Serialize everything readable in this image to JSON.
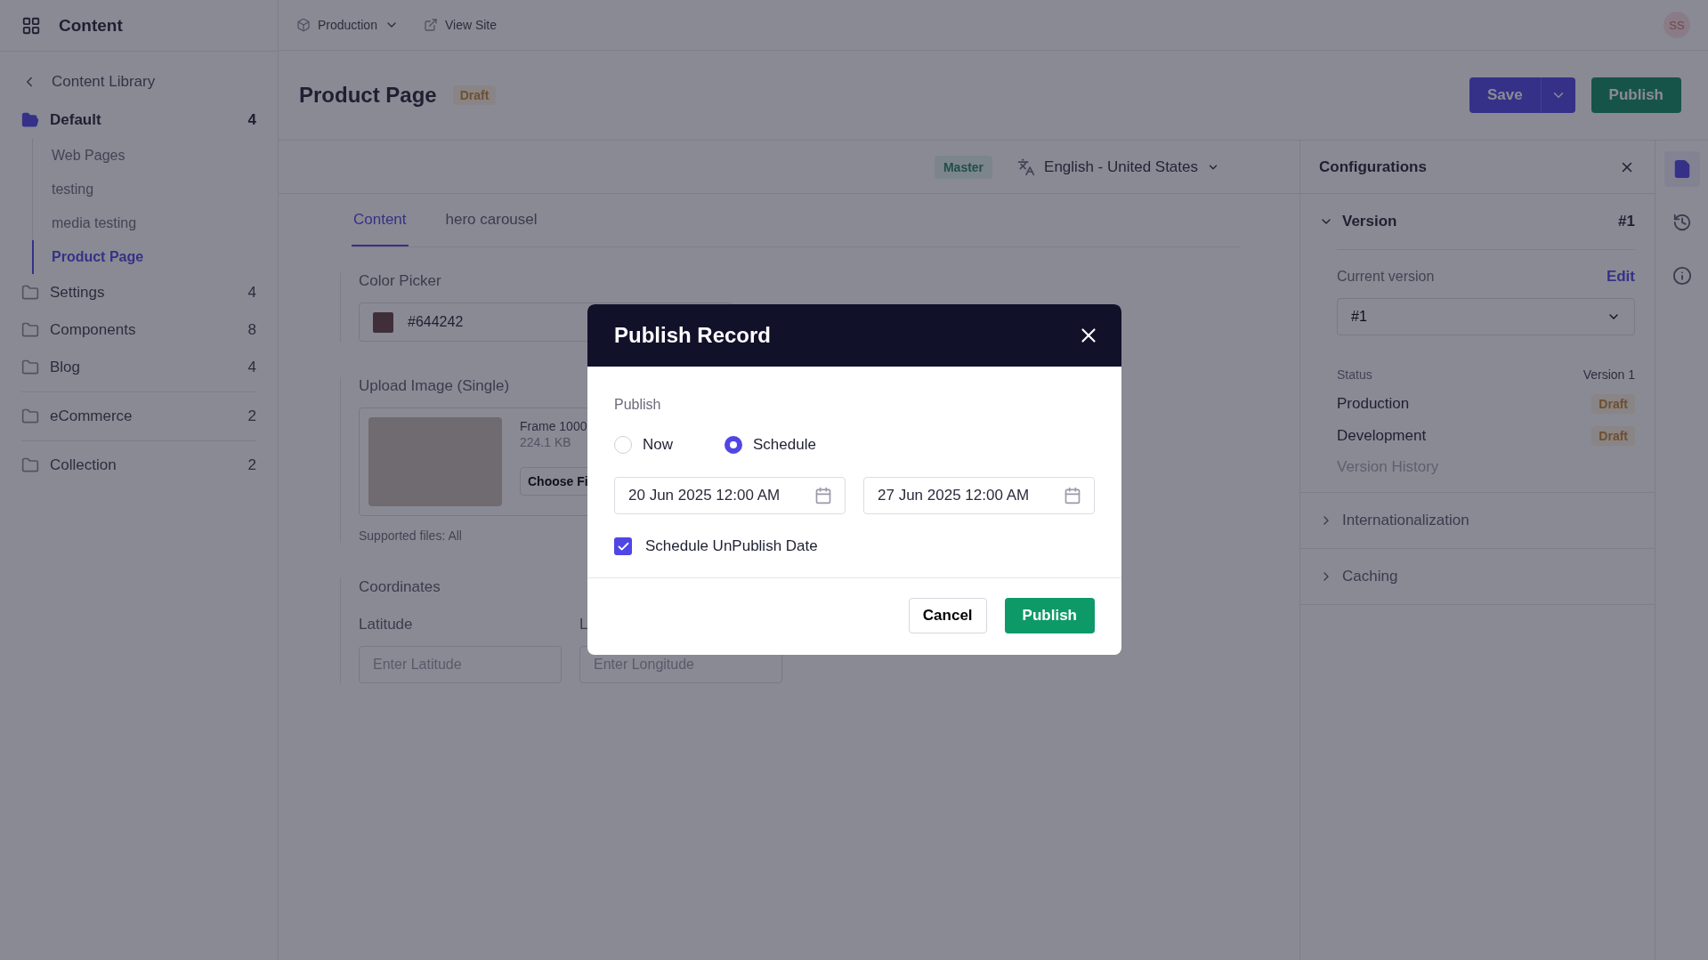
{
  "topbar": {
    "app_title": "Content",
    "environment": "Production",
    "view_site": "View Site",
    "avatar": "SS"
  },
  "sidebar": {
    "back": "Content Library",
    "groups": [
      [
        {
          "label": "Default",
          "count": "4",
          "expanded": true,
          "children": [
            {
              "label": "Web Pages",
              "selected": false
            },
            {
              "label": "testing",
              "selected": false
            },
            {
              "label": "media testing",
              "selected": false
            },
            {
              "label": "Product Page",
              "selected": true
            }
          ]
        },
        {
          "label": "Settings",
          "count": "4",
          "expanded": false
        },
        {
          "label": "Components",
          "count": "8",
          "expanded": false
        },
        {
          "label": "Blog",
          "count": "4",
          "expanded": false
        }
      ],
      [
        {
          "label": "eCommerce",
          "count": "2",
          "expanded": false
        }
      ],
      [
        {
          "label": "Collection",
          "count": "2",
          "expanded": false
        }
      ]
    ]
  },
  "header": {
    "title": "Product Page",
    "status": "Draft",
    "save": "Save",
    "publish": "Publish"
  },
  "locale_bar": {
    "branch": "Master",
    "language": "English - United States"
  },
  "tabs": [
    {
      "label": "Content",
      "selected": true
    },
    {
      "label": "hero carousel",
      "selected": false
    }
  ],
  "fields": {
    "color_picker": {
      "label": "Color Picker",
      "value": "#644242"
    },
    "upload": {
      "label": "Upload Image (Single)",
      "file_name": "Frame 1000",
      "size": "224.1 KB",
      "button": "Choose Fi",
      "note": "Supported files: All"
    },
    "coordinates": {
      "label": "Coordinates",
      "latitude": {
        "label": "Latitude",
        "placeholder": "Enter Latitude"
      },
      "longitude": {
        "label": "L",
        "placeholder": "Enter Longitude"
      }
    }
  },
  "config": {
    "title": "Configurations",
    "sections": [
      {
        "title": "Version",
        "expanded": true,
        "value": "#1",
        "current_label": "Current version",
        "edit": "Edit",
        "current": "#1",
        "status_label": "Status",
        "status_value": "Version 1",
        "environments": [
          {
            "name": "Production",
            "status": "Draft"
          },
          {
            "name": "Development",
            "status": "Draft"
          }
        ],
        "history": "Version History"
      },
      {
        "title": "Internationalization",
        "expanded": false
      },
      {
        "title": "Caching",
        "expanded": false
      }
    ]
  },
  "rail": [
    {
      "kind": "document",
      "selected": true
    },
    {
      "kind": "history",
      "selected": false
    },
    {
      "kind": "info",
      "selected": false
    }
  ],
  "modal": {
    "title": "Publish Record",
    "section": "Publish",
    "options": [
      {
        "label": "Now",
        "selected": false
      },
      {
        "label": "Schedule",
        "selected": true
      }
    ],
    "dates": [
      "20 Jun 2025 12:00 AM",
      "27 Jun 2025 12:00 AM"
    ],
    "unpublish": {
      "label": "Schedule UnPublish Date",
      "checked": true
    },
    "cancel": "Cancel",
    "confirm": "Publish"
  }
}
